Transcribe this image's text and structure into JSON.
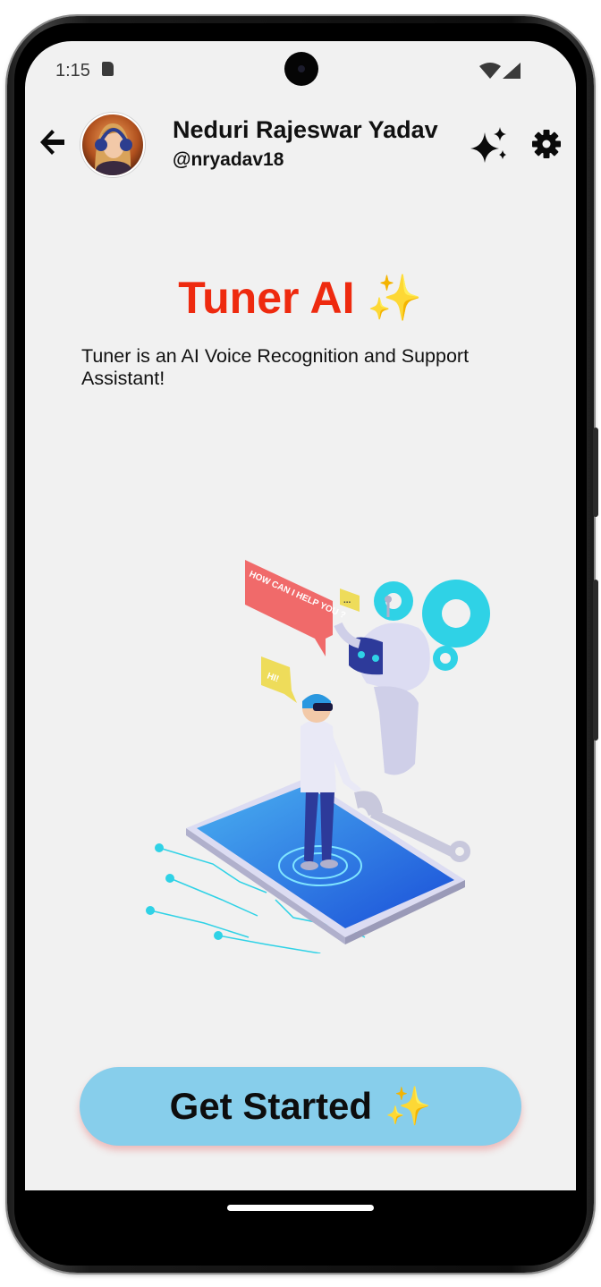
{
  "status_bar": {
    "time": "1:15"
  },
  "header": {
    "user_name": "Neduri Rajeswar Yadav",
    "user_handle": "@nryadav18",
    "icons": [
      "back-arrow-icon",
      "avatar",
      "sparkle-icon",
      "gear-icon"
    ]
  },
  "main": {
    "title": "Tuner AI",
    "title_emoji": "✨",
    "description": "Tuner is an AI Voice Recognition and Support Assistant!",
    "illustration": {
      "speech_bubble_robot": "HOW CAN I HELP YOU ?",
      "speech_bubble_person": "HI!",
      "speech_bubble_dots": "..."
    }
  },
  "cta": {
    "label": "Get Started",
    "emoji": "✨"
  },
  "colors": {
    "title": "#ee2a0f",
    "button": "#87ceeb",
    "background": "#f1f1f1"
  }
}
